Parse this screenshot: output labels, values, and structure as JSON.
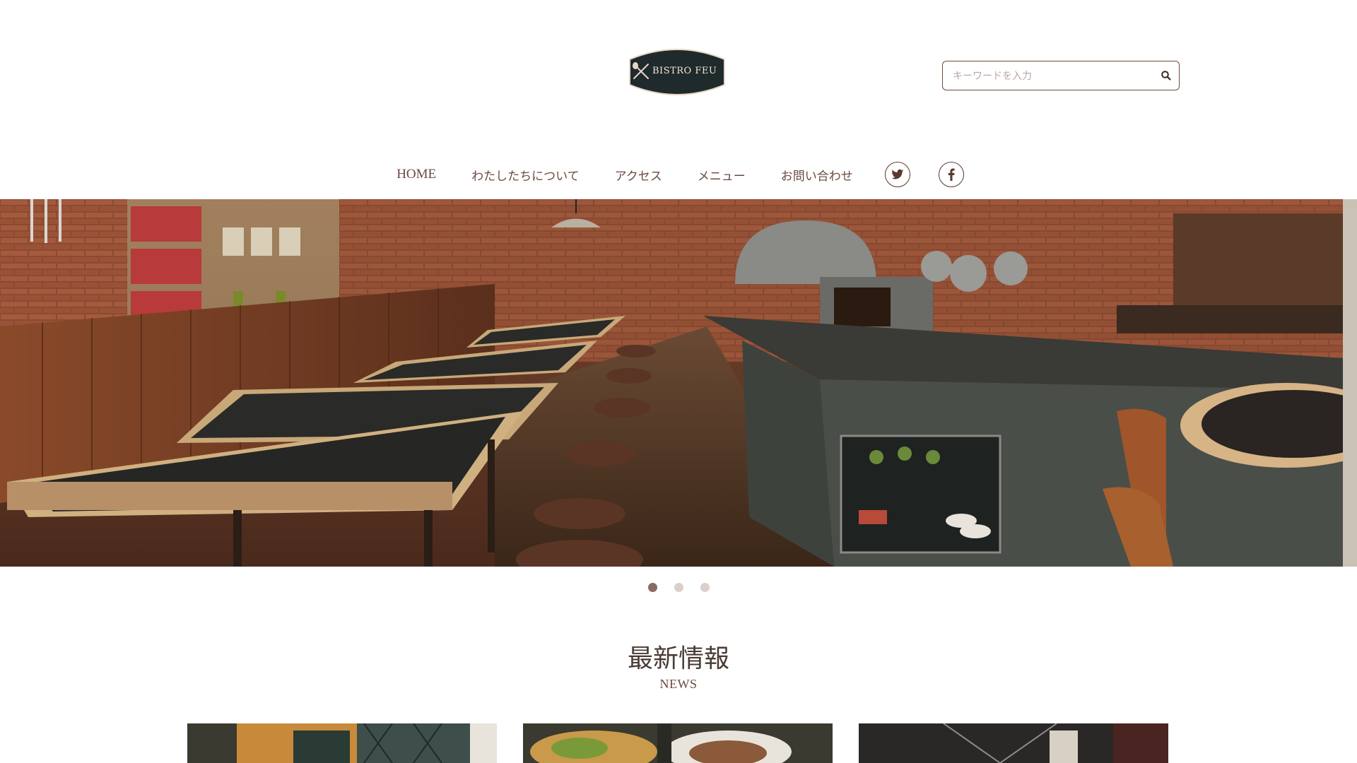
{
  "header": {
    "logo_text": "BISTRO   FEU",
    "search_placeholder": "キーワードを入力"
  },
  "nav": {
    "items": [
      {
        "label": "HOME"
      },
      {
        "label": "わたしたちについて"
      },
      {
        "label": "アクセス"
      },
      {
        "label": "メニュー"
      },
      {
        "label": "お問い合わせ"
      }
    ],
    "social": [
      "twitter-icon",
      "facebook-icon"
    ]
  },
  "carousel": {
    "slide_count": 3,
    "active_index": 0
  },
  "news": {
    "title": "最新情報",
    "subtitle": "NEWS"
  },
  "colors": {
    "brand_text": "#5a3a2e",
    "logo_bg": "#1f2a2c",
    "dot_active": "#8a6a62",
    "dot_inactive": "#dcd0cc"
  }
}
